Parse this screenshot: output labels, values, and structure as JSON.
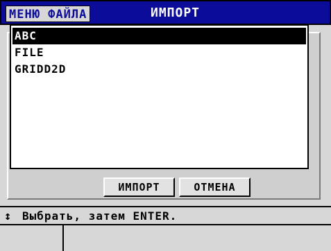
{
  "header": {
    "menu_label": "МЕНЮ ФАЙЛА",
    "title": "ИМПОРТ"
  },
  "file_list": {
    "items": [
      "ABC",
      "FILE",
      "GRIDD2D"
    ],
    "selected_index": 0
  },
  "buttons": {
    "import_label": "ИМПОРТ",
    "cancel_label": "ОТМЕНА"
  },
  "help": {
    "icon": "up-down-arrow-icon",
    "text": "Выбрать, затем ENTER."
  },
  "colors": {
    "title_bar": "#0c0c9a",
    "background": "#d7d7d7",
    "selection": "#000000"
  }
}
